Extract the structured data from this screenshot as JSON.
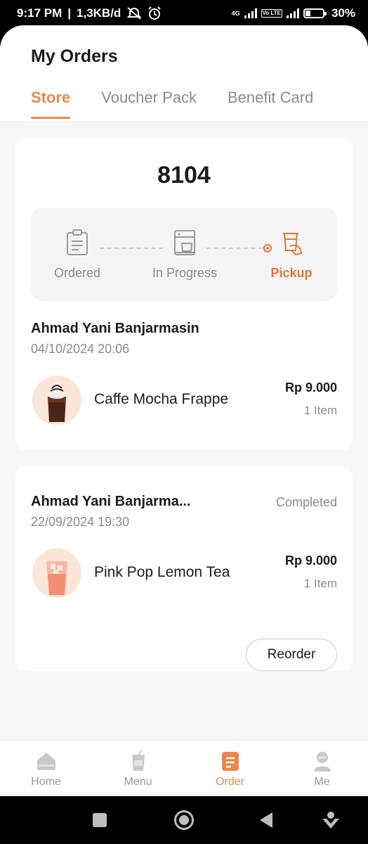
{
  "statusbar": {
    "time": "9:17 PM",
    "network_speed": "1,3KB/d",
    "net_tag": "4G",
    "volte_tag": "Vo LTE",
    "battery": "30%",
    "battery_level": 0.3,
    "icons": [
      "mute-icon",
      "alarm-icon",
      "signal-icon",
      "battery-icon"
    ]
  },
  "header": {
    "title": "My Orders",
    "tabs": [
      {
        "label": "Store",
        "active": true
      },
      {
        "label": "Voucher Pack",
        "active": false
      },
      {
        "label": "Benefit Card",
        "active": false
      }
    ]
  },
  "active_order": {
    "order_number": "8104",
    "steps": [
      {
        "label": "Ordered",
        "icon": "clipboard-icon",
        "active": false
      },
      {
        "label": "In Progress",
        "icon": "coffee-machine-icon",
        "active": false
      },
      {
        "label": "Pickup",
        "icon": "pickup-cup-hand-icon",
        "active": true
      }
    ],
    "store": "Ahmad Yani Banjarmasin",
    "datetime": "04/10/2024 20:06",
    "item": {
      "name": "Caffe Mocha Frappe",
      "price": "Rp 9.000",
      "qty": "1 Item"
    }
  },
  "past_order": {
    "store": "Ahmad Yani Banjarma...",
    "status": "Completed",
    "datetime": "22/09/2024 19:30",
    "item": {
      "name": "Pink Pop Lemon Tea",
      "price": "Rp 9.000",
      "qty": "1 Item"
    },
    "reorder_label": "Reorder"
  },
  "bottom_nav": [
    {
      "label": "Home",
      "icon": "home-icon",
      "active": false
    },
    {
      "label": "Menu",
      "icon": "cup-icon",
      "active": false
    },
    {
      "label": "Order",
      "icon": "order-list-icon",
      "active": true
    },
    {
      "label": "Me",
      "icon": "profile-icon",
      "active": false
    }
  ],
  "colors": {
    "accent": "#e8884a",
    "muted": "#8b8b8b",
    "text": "#1b1b1b",
    "background": "#f6f6f6"
  }
}
